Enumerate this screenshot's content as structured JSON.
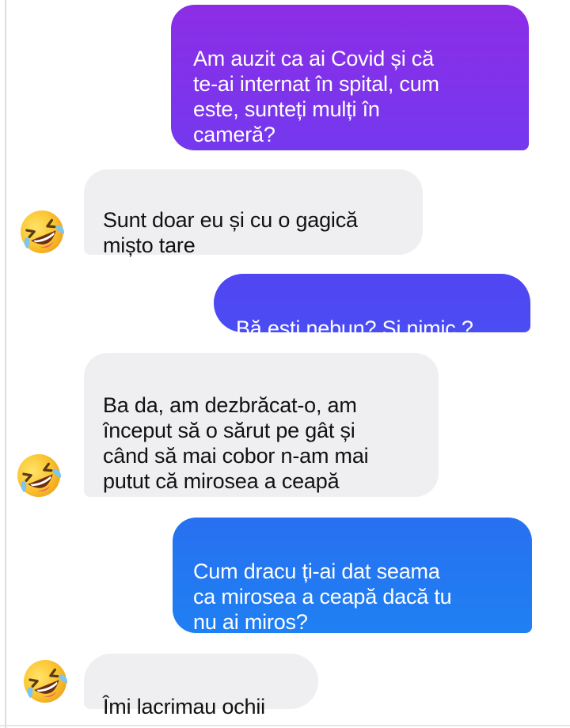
{
  "conversation": {
    "messages": [
      {
        "side": "sent",
        "text": "Am auzit ca ai Covid și că\nte-ai internat în spital, cum\neste, sunteți mulți în\ncameră?"
      },
      {
        "side": "received",
        "text": "Sunt doar eu și cu o gagică\nmișto tare"
      },
      {
        "side": "sent",
        "text": "Bă ești nebun? Și nimic ?"
      },
      {
        "side": "received",
        "text": "Ba da, am dezbrăcat-o, am\nînceput să o sărut pe gât și\ncând să mai cobor n-am mai\nputut că mirosea a ceapă"
      },
      {
        "side": "sent",
        "text": "Cum dracu ți-ai dat seama\nca mirosea a ceapă dacă tu\nnu ai miros?"
      },
      {
        "side": "received",
        "text": "Îmi lacrimau ochii"
      }
    ],
    "reaction_icon": "rolling-on-floor-laughing-emoji"
  },
  "colors": {
    "sent_gradient": [
      "#8a2be2",
      "#6a3cf0",
      "#3f55f4",
      "#1e7af2"
    ],
    "received_bg": "#efeff1",
    "emoji_face": "#f9c52f"
  }
}
